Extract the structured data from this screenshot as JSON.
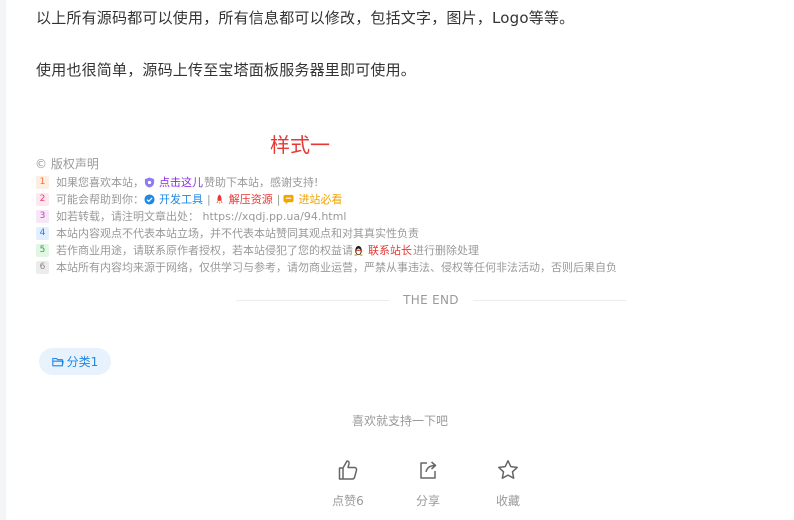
{
  "content": {
    "paragraph_1": "以上所有源码都可以使用，所有信息都可以修改，包括文字，图片，Logo等等。",
    "paragraph_2": "使用也很简单，源码上传至宝塔面板服务器里即可使用。",
    "style_label": "样式一"
  },
  "copyright": {
    "heading": "© 版权声明",
    "rows": [
      {
        "num": "1",
        "before": "如果您喜欢本站，",
        "link": "点击这儿",
        "after": "赞助下本站，感谢支持!"
      },
      {
        "num": "2",
        "before": "可能会帮助到你：",
        "link_a": "开发工具",
        "link_b": "解压资源",
        "link_c": "进站必看",
        "divider": "|"
      },
      {
        "num": "3",
        "text": "如若转载，请注明文章出处： https://xqdj.pp.ua/94.html"
      },
      {
        "num": "4",
        "text": "本站内容观点不代表本站立场，并不代表本站赞同其观点和对其真实性负责"
      },
      {
        "num": "5",
        "before": "若作商业用途，请联系原作者授权，若本站侵犯了您的权益请",
        "link": "联系站长",
        "after": "进行删除处理"
      },
      {
        "num": "6",
        "text": "本站所有内容均来源于网络，仅供学习与参考，请勿商业运营，严禁从事违法、侵权等任何非法活动，否则后果自负"
      }
    ]
  },
  "end_marker": "THE END",
  "category_tag": "分类1",
  "support": {
    "prompt": "喜欢就支持一下吧",
    "like_label": "点赞6",
    "share_label": "分享",
    "favorite_label": "收藏"
  },
  "colors": {
    "style_label": "#e53935",
    "link_purple": "#8a2be2",
    "link_blue": "#1e88e5",
    "link_red": "#e53935",
    "link_gold": "#f0a500",
    "tag_bg": "#e8f2fd"
  },
  "icons": [
    "shield-icon",
    "verified-icon",
    "rocket-icon",
    "chat-icon",
    "qq-penguin-icon",
    "folder-icon",
    "thumbs-up-icon",
    "share-icon",
    "star-icon"
  ]
}
